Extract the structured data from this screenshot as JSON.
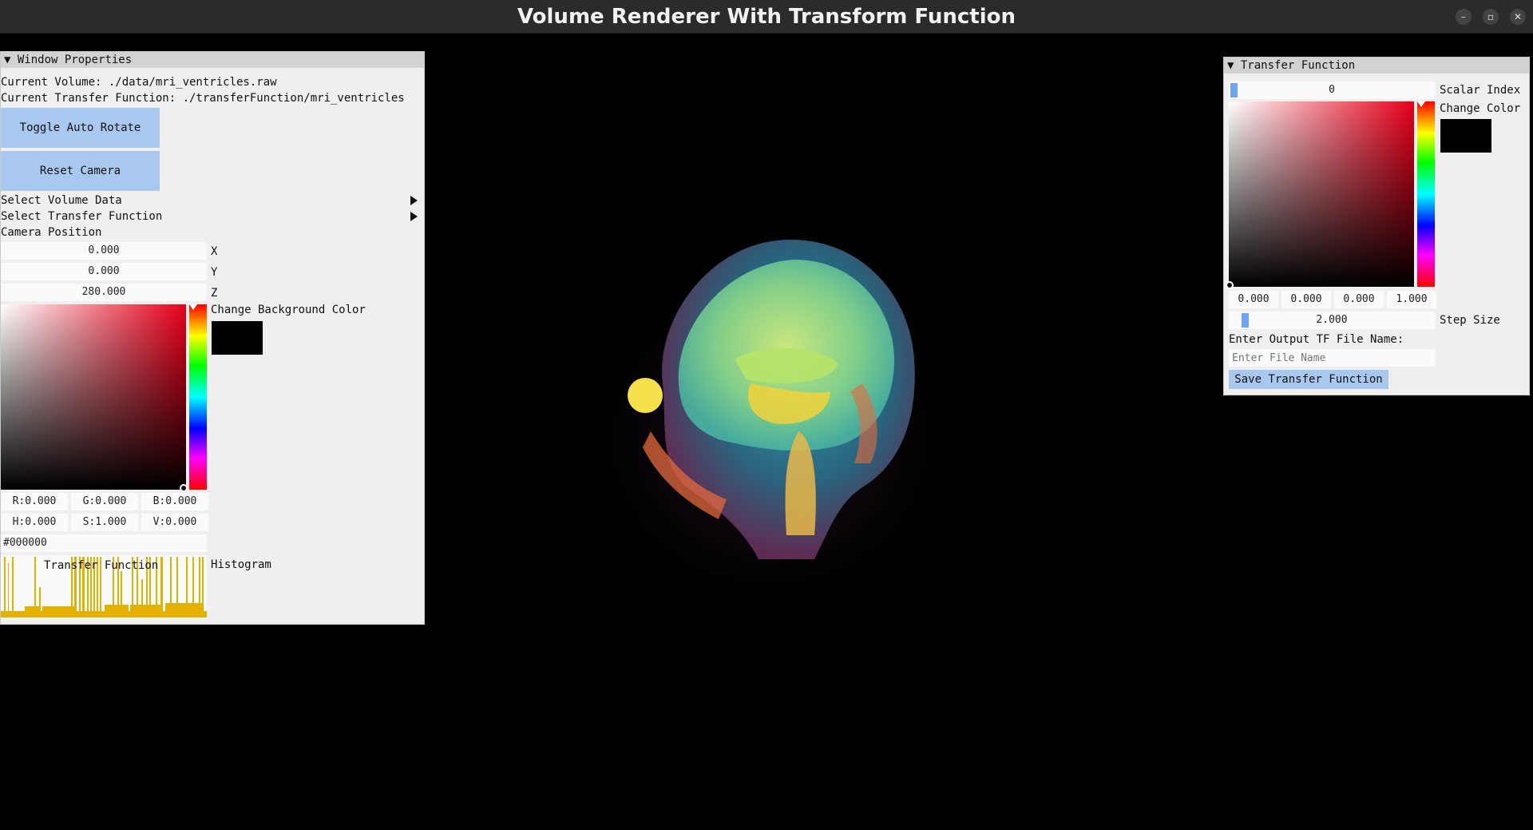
{
  "window": {
    "title": "Volume Renderer With Transform Function",
    "min_icon": "minimize-icon",
    "max_icon": "restore-icon",
    "close_icon": "close-icon"
  },
  "left_panel": {
    "header": "Window Properties",
    "current_volume": "Current Volume: ./data/mri_ventricles.raw",
    "current_tf": "Current Transfer Function: ./transferFunction/mri_ventricles",
    "toggle_auto_rotate": "Toggle Auto Rotate",
    "reset_camera": "Reset Camera",
    "select_volume_data": "Select Volume Data",
    "select_transfer_function": "Select Transfer Function",
    "camera_position_label": "Camera Position",
    "camera": {
      "x": {
        "value": "0.000",
        "label": "X"
      },
      "y": {
        "value": "0.000",
        "label": "Y"
      },
      "z": {
        "value": "280.000",
        "label": "Z"
      }
    },
    "bg_color_label": "Change Background Color",
    "bg_color": "#000000",
    "rgb": {
      "r": "R:0.000",
      "g": "G:0.000",
      "b": "B:0.000"
    },
    "hsv": {
      "h": "H:0.000",
      "s": "S:1.000",
      "v": "V:0.000"
    },
    "hex": "#000000",
    "histogram_overlay": "Transfer Function",
    "histogram_label": "Histogram",
    "histogram_color": "#e5b100"
  },
  "right_panel": {
    "header": "Transfer Function",
    "scalar_index_value": "0",
    "scalar_index_label": "Scalar Index",
    "change_color_label": "Change Color",
    "color": "#000000",
    "rgba": [
      "0.000",
      "0.000",
      "0.000",
      "1.000"
    ],
    "step_size_value": "2.000",
    "step_size_label": "Step Size",
    "output_label": "Enter Output TF File Name:",
    "file_placeholder": "Enter File Name",
    "save_button": "Save Transfer Function"
  }
}
